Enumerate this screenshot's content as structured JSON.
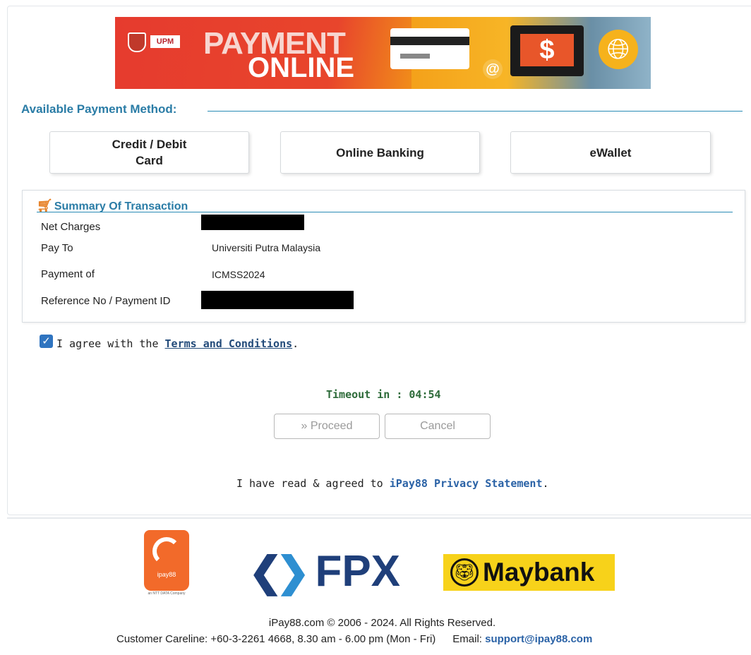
{
  "banner": {
    "logo_text": "UPM",
    "title_line1": "PAYMENT",
    "title_line2": "ONLINE",
    "at_symbol": "@",
    "dollar_symbol": "$",
    "globe_icon": "globe-icon"
  },
  "payment_methods": {
    "heading": "Available Payment Method:",
    "credit_line1": "Credit / Debit",
    "credit_line2": "Card",
    "online_banking": "Online Banking",
    "ewallet": "eWallet"
  },
  "summary": {
    "title": "Summary Of Transaction",
    "cart_icon": "shopping-cart-icon",
    "rows": [
      {
        "label": "Net Charges",
        "value": ""
      },
      {
        "label": "Pay To",
        "value": "Universiti Putra Malaysia"
      },
      {
        "label": "Payment of",
        "value": "ICMSS2024"
      },
      {
        "label": "Reference No / Payment ID",
        "value": ""
      }
    ]
  },
  "agreement": {
    "checked": true,
    "text_before": "I agree with the ",
    "link_text": "Terms and Conditions",
    "text_after": "."
  },
  "timeout": {
    "text": "Timeout in : 04:54"
  },
  "buttons": {
    "proceed": "» Proceed",
    "cancel": "Cancel"
  },
  "privacy": {
    "text_before": "I have read & agreed to ",
    "link_text": "iPay88 Privacy Statement",
    "text_after": "."
  },
  "footer": {
    "ipay88_logo_text": "ipay88",
    "ipay88_caption": "an NTT DATA Company",
    "fpx_text": "FPX",
    "maybank_text": "Maybank",
    "copyright": "iPay88.com © 2006 - 2024. All Rights Reserved.",
    "careline": "Customer Careline: +60-3-2261 4668, 8.30 am - 6.00 pm (Mon - Fri)",
    "email_label": "Email: ",
    "email": "support@ipay88.com"
  },
  "colors": {
    "accent_blue": "#2a7ca6",
    "timeout_green": "#2e6b3a",
    "link_blue": "#2a62a6",
    "banner_red": "#e63b2e",
    "maybank_yellow": "#f7d21a",
    "ipay_orange": "#f26a2a",
    "fpx_navy": "#1f3f7a"
  }
}
